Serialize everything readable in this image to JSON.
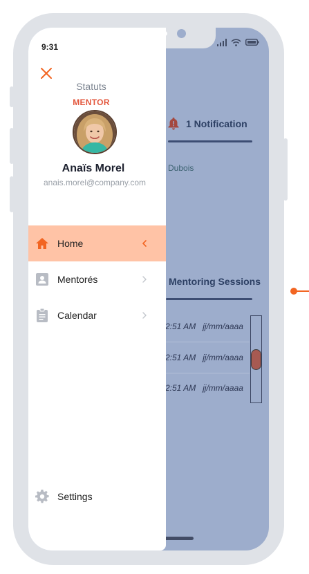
{
  "device": {
    "time": "9:31"
  },
  "drawer": {
    "status_label": "Statuts",
    "role": "MENTOR",
    "user_name": "Anaïs Morel",
    "user_email": "anais.morel@company.com",
    "menu": [
      {
        "label": "Home",
        "icon": "home-icon",
        "active": true
      },
      {
        "label": "Mentorés",
        "icon": "person-card-icon",
        "active": false
      },
      {
        "label": "Calendar",
        "icon": "clipboard-icon",
        "active": false
      }
    ],
    "settings_label": "Settings"
  },
  "background_app": {
    "notification_label": "1 Notification",
    "person_name": "Dubois",
    "sessions_title": "Mentoring Sessions",
    "sessions": [
      {
        "time": "2:51 AM",
        "date": "jj/mm/aaaa"
      },
      {
        "time": "2:51 AM",
        "date": "jj/mm/aaaa"
      },
      {
        "time": "2:51 AM",
        "date": "jj/mm/aaaa"
      }
    ]
  },
  "colors": {
    "accent": "#f26522",
    "active_menu_bg": "#ffc3a6",
    "role_red": "#e3573d",
    "overlay_blue": "#9dadcc",
    "frame": "#dfe2e7"
  }
}
